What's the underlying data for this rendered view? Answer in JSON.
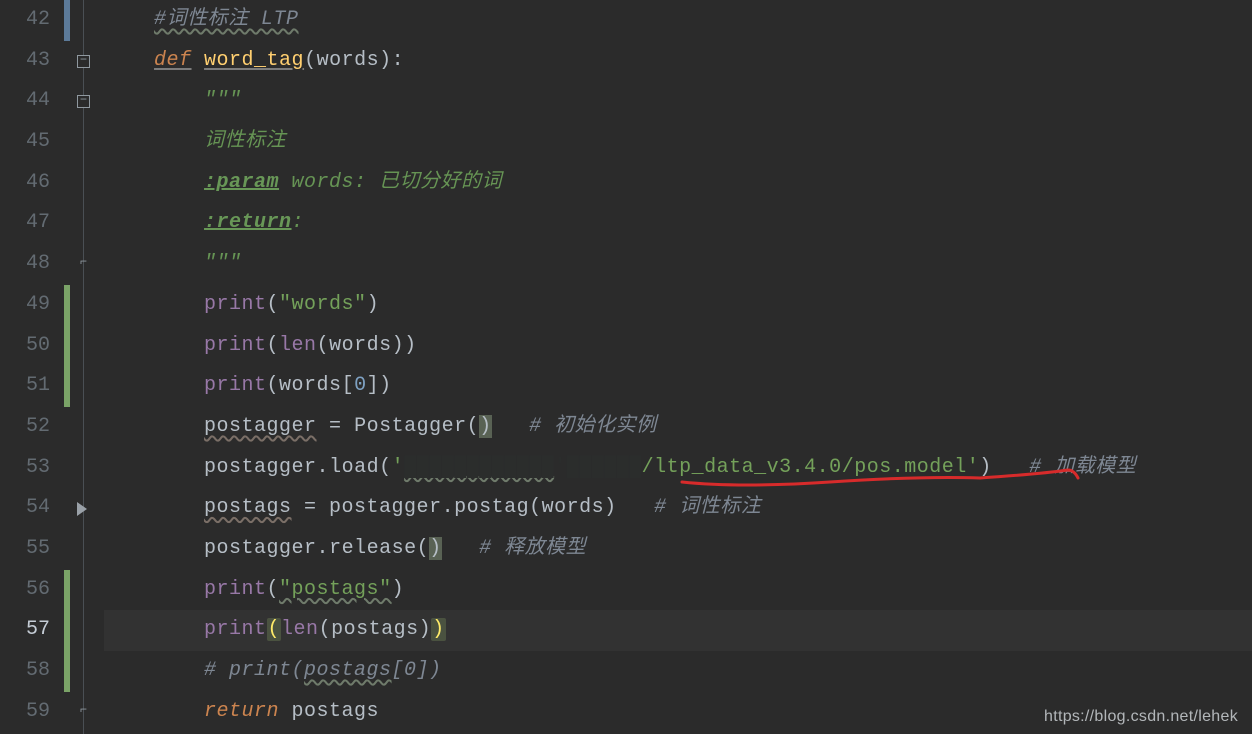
{
  "watermark": "https://blog.csdn.net/lehek",
  "editor": {
    "current_line": 57,
    "lines": [
      {
        "num": "42"
      },
      {
        "num": "43"
      },
      {
        "num": "44"
      },
      {
        "num": "45"
      },
      {
        "num": "46"
      },
      {
        "num": "47"
      },
      {
        "num": "48"
      },
      {
        "num": "49"
      },
      {
        "num": "50"
      },
      {
        "num": "51"
      },
      {
        "num": "52"
      },
      {
        "num": "53"
      },
      {
        "num": "54"
      },
      {
        "num": "55"
      },
      {
        "num": "56"
      },
      {
        "num": "57"
      },
      {
        "num": "58"
      },
      {
        "num": "59"
      }
    ]
  },
  "tokens": {
    "l42_comment": "#词性标注 LTP",
    "l43_def": "def",
    "l43_fn": "word_tag",
    "l43_lpar": "(",
    "l43_arg": "words",
    "l43_rparcolon": "):",
    "l44_doc": "\"\"\"",
    "l45_doc": "词性标注",
    "l46_tag": ":param",
    "l46_rest": " words: 已切分好的词",
    "l47_tag": ":return",
    "l47_rest": ":",
    "l48_doc": "\"\"\"",
    "l49_print": "print",
    "l49_l": "(",
    "l49_str": "\"words\"",
    "l49_r": ")",
    "l50_print": "print",
    "l50_l": "(",
    "l50_len": "len",
    "l50_l2": "(",
    "l50_arg": "words",
    "l50_r2": ")",
    "l50_r": ")",
    "l51_print": "print",
    "l51_l": "(",
    "l51_arg": "words",
    "l51_lb": "[",
    "l51_idx": "0",
    "l51_rb": "]",
    "l51_r": ")",
    "l52_var": "postagger",
    "l52_eq": " = ",
    "l52_cls": "Postagger",
    "l52_l": "(",
    "l52_r": ")",
    "l52_cmt": "# 初始化实例",
    "l53_obj": "postagger",
    "l53_dot": ".",
    "l53_m": "load",
    "l53_l": "(",
    "l53_q1": "'",
    "l53_red1": "████████████",
    "l53_red2": "'██████",
    "l53_path": "/ltp_data_v3.4.0/pos.model",
    "l53_q2": "'",
    "l53_r": ")",
    "l53_cmt": "# 加载模型",
    "l54_var": "postags",
    "l54_eq": " = ",
    "l54_obj": "postagger",
    "l54_dot": ".",
    "l54_m": "postag",
    "l54_l": "(",
    "l54_arg": "words",
    "l54_r": ")",
    "l54_cmt": "# 词性标注",
    "l55_obj": "postagger",
    "l55_dot": ".",
    "l55_m": "release",
    "l55_l": "(",
    "l55_r": ")",
    "l55_cmt": "# 释放模型",
    "l56_print": "print",
    "l56_l": "(",
    "l56_str": "\"postags\"",
    "l56_r": ")",
    "l57_print": "print",
    "l57_l": "(",
    "l57_len": "len",
    "l57_l2": "(",
    "l57_arg": "postags",
    "l57_r2": ")",
    "l57_r": ")",
    "l58_cmt": "# print(postags[0])",
    "l58_cmt_a": "# print(",
    "l58_cmt_b": "postags",
    "l58_cmt_c": "[0])",
    "l59_ret": "return",
    "l59_var": "postags"
  }
}
